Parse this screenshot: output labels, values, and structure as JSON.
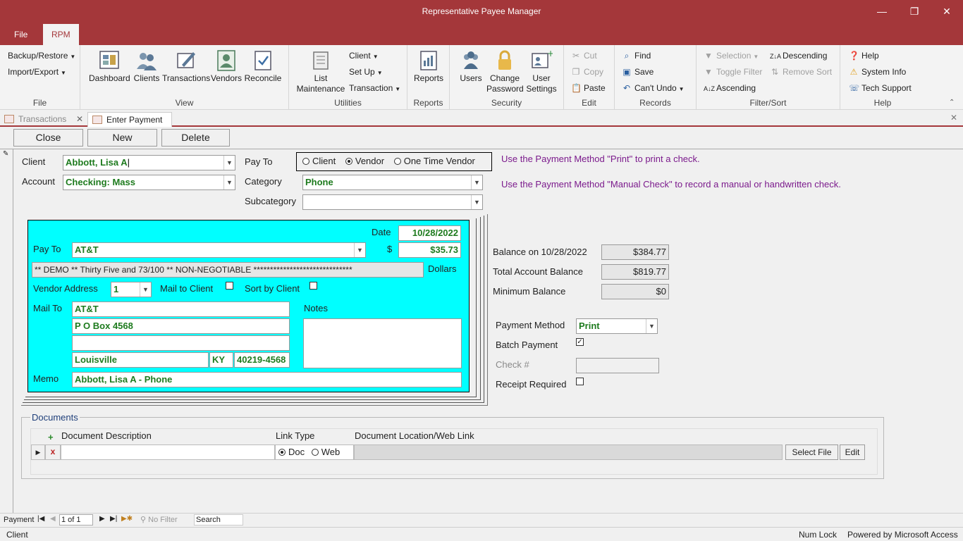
{
  "window": {
    "title": "Representative Payee Manager",
    "qat_icon": "chevron-down-icon",
    "controls": {
      "minimize": "—",
      "restore": "❐",
      "close": "✕"
    }
  },
  "ribbon_tabs": [
    {
      "label": "File"
    },
    {
      "label": "RPM"
    }
  ],
  "ribbon": {
    "file_group": {
      "label": "File",
      "backup": "Backup/Restore",
      "import": "Import/Export"
    },
    "view_group": {
      "label": "View",
      "buttons": [
        "Dashboard",
        "Clients",
        "Transactions",
        "Vendors",
        "Reconcile"
      ]
    },
    "utilities_group": {
      "label": "Utilities",
      "list1": "List",
      "list2": "Maintenance",
      "client": "Client",
      "setup": "Set Up",
      "transaction": "Transaction"
    },
    "reports_group": {
      "label": "Reports",
      "reports": "Reports"
    },
    "security_group": {
      "label": "Security",
      "users": "Users",
      "change1": "Change",
      "change2": "Password",
      "user1": "User",
      "user2": "Settings"
    },
    "edit_group": {
      "label": "Edit",
      "cut": "Cut",
      "copy": "Copy",
      "paste": "Paste"
    },
    "records_group": {
      "label": "Records",
      "find": "Find",
      "save": "Save",
      "undo": "Can't Undo"
    },
    "filter_group": {
      "label": "Filter/Sort",
      "selection": "Selection",
      "toggle": "Toggle Filter",
      "ascending": "Ascending",
      "descending": "Descending",
      "remove_sort": "Remove Sort",
      "ascending_icon": "A↓Z",
      "descending_icon": "Z↓A"
    },
    "help_group": {
      "label": "Help",
      "help": "Help",
      "system": "System Info",
      "tech": "Tech Support"
    }
  },
  "doc_tabs": [
    {
      "label": "Transactions"
    },
    {
      "label": "Enter Payment"
    }
  ],
  "commands": {
    "close": "Close",
    "new": "New",
    "delete": "Delete"
  },
  "form": {
    "client_label": "Client",
    "client_value": "Abbott, Lisa A",
    "account_label": "Account",
    "account_value": "Checking: Mass",
    "payto_label": "Pay To",
    "payto_options": [
      "Client",
      "Vendor",
      "One Time Vendor"
    ],
    "payto_selected": "Vendor",
    "category_label": "Category",
    "category_value": "Phone",
    "subcategory_label": "Subcategory",
    "subcategory_value": "",
    "hint1": "Use the Payment Method \"Print\" to print a check.",
    "hint2": "Use the Payment Method \"Manual Check\" to record a manual or handwritten check."
  },
  "check": {
    "date_label": "Date",
    "date_value": "10/28/2022",
    "payto_label": "Pay To",
    "payto_value": "AT&T",
    "dollar_sign": "$",
    "amount": "$35.73",
    "amount_words": "** DEMO ** Thirty Five and 73/100 ** NON-NEGOTIABLE ******************************",
    "dollars_label": "Dollars",
    "vendor_address_label": "Vendor Address",
    "vendor_address_value": "1",
    "mail_to_client_label": "Mail to Client",
    "sort_by_client_label": "Sort by Client",
    "mail_to_label": "Mail To",
    "mail_line1": "AT&T",
    "mail_line2": "P O Box 4568",
    "mail_line3": "",
    "city": "Louisville",
    "state": "KY",
    "zip": "40219-4568",
    "notes_label": "Notes",
    "memo_label": "Memo",
    "memo_value": "Abbott, Lisa A - Phone"
  },
  "balances": {
    "balance_label": "Balance on 10/28/2022",
    "balance_value": "$384.77",
    "total_label": "Total Account Balance",
    "total_value": "$819.77",
    "min_label": "Minimum Balance",
    "min_value": "$0"
  },
  "payment": {
    "method_label": "Payment Method",
    "method_value": "Print",
    "batch_label": "Batch Payment",
    "batch_checked": "✓",
    "checknum_label": "Check #",
    "receipt_label": "Receipt Required"
  },
  "documents": {
    "title": "Documents",
    "col_description": "Document Description",
    "col_linktype": "Link Type",
    "col_location": "Document Location/Web Link",
    "add_symbol": "+",
    "delete_symbol": "x",
    "link_doc": "Doc",
    "link_web": "Web",
    "select_file": "Select File",
    "edit": "Edit"
  },
  "navbar": {
    "label": "Payment",
    "record": "1 of 1",
    "no_filter": "No Filter",
    "search": "Search"
  },
  "status": {
    "left": "Client",
    "num_lock": "Num Lock",
    "powered": "Powered by Microsoft Access"
  }
}
